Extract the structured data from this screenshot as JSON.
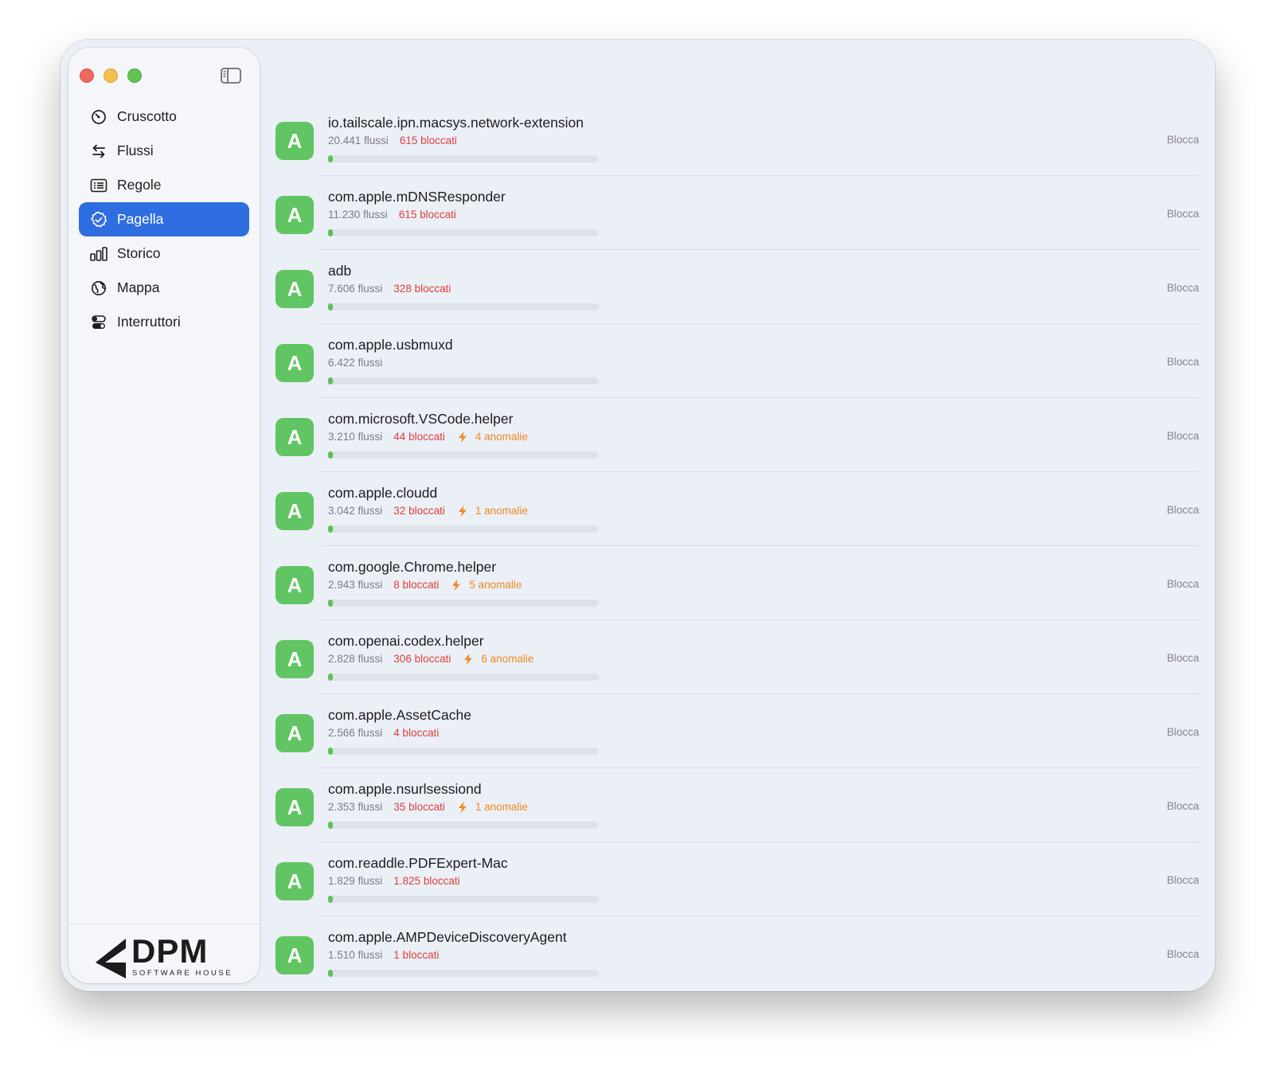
{
  "window": {
    "traffic_lights": {
      "close": "#ed6a5e",
      "minimize": "#f4bf4f",
      "maximize": "#61c554"
    }
  },
  "sidebar": {
    "toggle_icon": "sidebar-toggle-icon",
    "items": [
      {
        "label": "Cruscotto",
        "icon": "gauge-icon",
        "active": false
      },
      {
        "label": "Flussi",
        "icon": "arrows-swap-icon",
        "active": false
      },
      {
        "label": "Regole",
        "icon": "list-rules-icon",
        "active": false
      },
      {
        "label": "Pagella",
        "icon": "seal-check-icon",
        "active": true
      },
      {
        "label": "Storico",
        "icon": "bar-chart-icon",
        "active": false
      },
      {
        "label": "Mappa",
        "icon": "globe-icon",
        "active": false
      },
      {
        "label": "Interruttori",
        "icon": "toggles-icon",
        "active": false
      }
    ],
    "logo": {
      "name": "DPM",
      "tagline": "SOFTWARE HOUSE"
    }
  },
  "colors": {
    "accent": "#2f6ee0",
    "grade_green": "#61c563",
    "blocked_red": "#e0403c",
    "anomaly_orange": "#f08a24"
  },
  "apps": [
    {
      "grade": "A",
      "name": "io.tailscale.ipn.macsys.network-extension",
      "flows": "20.441 flussi",
      "blocked": "615 bloccati",
      "anomalies": "",
      "progress": 0.015,
      "action": "Blocca"
    },
    {
      "grade": "A",
      "name": "com.apple.mDNSResponder",
      "flows": "11.230 flussi",
      "blocked": "615 bloccati",
      "anomalies": "",
      "progress": 0.015,
      "action": "Blocca"
    },
    {
      "grade": "A",
      "name": "adb",
      "flows": "7.606 flussi",
      "blocked": "328 bloccati",
      "anomalies": "",
      "progress": 0.015,
      "action": "Blocca"
    },
    {
      "grade": "A",
      "name": "com.apple.usbmuxd",
      "flows": "6.422 flussi",
      "blocked": "",
      "anomalies": "",
      "progress": 0.015,
      "action": "Blocca"
    },
    {
      "grade": "A",
      "name": "com.microsoft.VSCode.helper",
      "flows": "3.210 flussi",
      "blocked": "44 bloccati",
      "anomalies": "4 anomalie",
      "progress": 0.015,
      "action": "Blocca"
    },
    {
      "grade": "A",
      "name": "com.apple.cloudd",
      "flows": "3.042 flussi",
      "blocked": "32 bloccati",
      "anomalies": "1 anomalie",
      "progress": 0.015,
      "action": "Blocca"
    },
    {
      "grade": "A",
      "name": "com.google.Chrome.helper",
      "flows": "2.943 flussi",
      "blocked": "8 bloccati",
      "anomalies": "5 anomalie",
      "progress": 0.015,
      "action": "Blocca"
    },
    {
      "grade": "A",
      "name": "com.openai.codex.helper",
      "flows": "2.828 flussi",
      "blocked": "306 bloccati",
      "anomalies": "6 anomalie",
      "progress": 0.015,
      "action": "Blocca"
    },
    {
      "grade": "A",
      "name": "com.apple.AssetCache",
      "flows": "2.566 flussi",
      "blocked": "4 bloccati",
      "anomalies": "",
      "progress": 0.015,
      "action": "Blocca"
    },
    {
      "grade": "A",
      "name": "com.apple.nsurlsessiond",
      "flows": "2.353 flussi",
      "blocked": "35 bloccati",
      "anomalies": "1 anomalie",
      "progress": 0.015,
      "action": "Blocca"
    },
    {
      "grade": "A",
      "name": "com.readdle.PDFExpert-Mac",
      "flows": "1.829 flussi",
      "blocked": "1.825 bloccati",
      "anomalies": "",
      "progress": 0.015,
      "action": "Blocca"
    },
    {
      "grade": "A",
      "name": "com.apple.AMPDeviceDiscoveryAgent",
      "flows": "1.510 flussi",
      "blocked": "1 bloccati",
      "anomalies": "",
      "progress": 0.015,
      "action": "Blocca"
    }
  ]
}
